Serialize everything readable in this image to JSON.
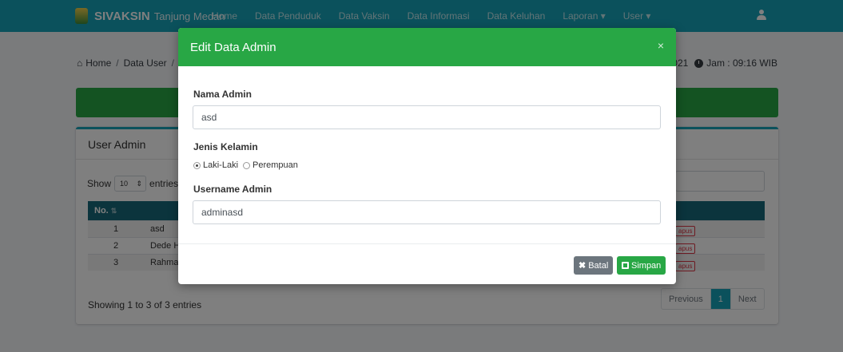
{
  "navbar": {
    "brand": "SIVAKSIN",
    "brand_sub": "Tanjung Medan",
    "items": [
      "Home",
      "Data Penduduk",
      "Data Vaksin",
      "Data Informasi",
      "Data Keluhan",
      "Laporan ▾",
      "User ▾"
    ],
    "user_icon": "user-icon"
  },
  "breadcrumb": {
    "home": "Home",
    "sep": "/",
    "item1": "Data User",
    "sep2": "/"
  },
  "datetime": {
    "date": "i 2021",
    "time": "Jam : 09:16 WIB"
  },
  "card": {
    "title": "User Admin",
    "show_label": "Show",
    "show_value": "10",
    "entries_label": "entries",
    "columns": {
      "no": "No."
    },
    "rows": [
      {
        "no": "1",
        "name": "asd",
        "action": "apus"
      },
      {
        "no": "2",
        "name": "Dede H",
        "action": "apus"
      },
      {
        "no": "3",
        "name": "Rahma",
        "action": "apus"
      }
    ],
    "showing": "Showing 1 to 3 of 3 entries",
    "pager": {
      "previous": "Previous",
      "page": "1",
      "next": "Next"
    }
  },
  "modal": {
    "title": "Edit Data Admin",
    "close": "×",
    "nama_label": "Nama Admin",
    "nama_value": "asd",
    "jk_label": "Jenis Kelamin",
    "jk_options": [
      "Laki-Laki",
      "Perempuan"
    ],
    "jk_selected": "Laki-Laki",
    "username_label": "Username Admin",
    "username_value": "adminasd",
    "batal_label": "Batal",
    "simpan_label": "Simpan"
  },
  "colors": {
    "navbar": "#17a2b8",
    "modal_header": "#28a745",
    "btn_batal": "#6c757d",
    "btn_simpan": "#28a745",
    "table_header": "#17687a"
  }
}
